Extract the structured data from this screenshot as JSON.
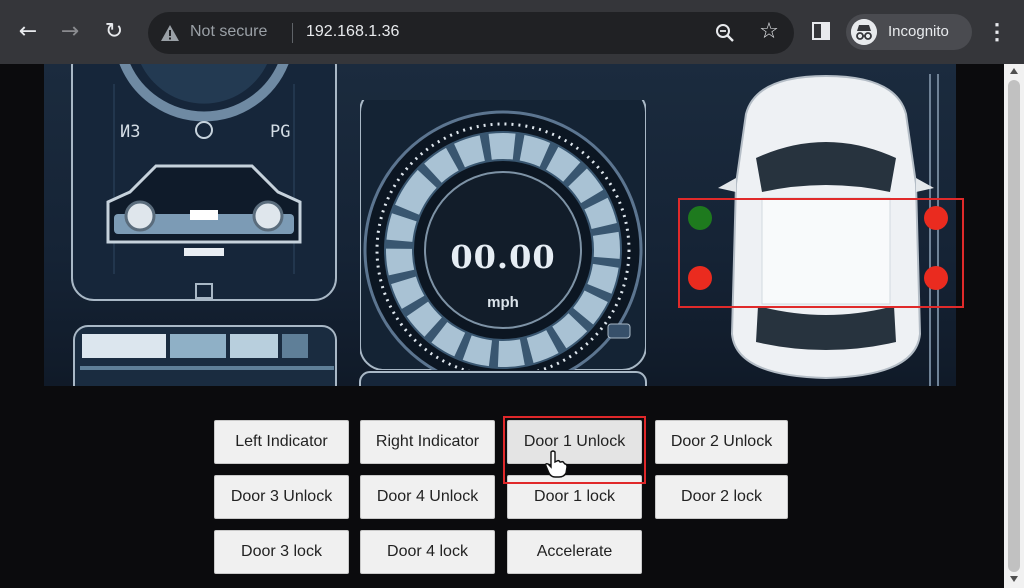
{
  "browser": {
    "security_label": "Not secure",
    "url": "192.168.1.36",
    "incognito_label": "Incognito",
    "icons": [
      "back-icon",
      "forward-icon",
      "reload-icon",
      "warning-icon",
      "zoom-icon",
      "star-icon",
      "side-panel-icon",
      "incognito-icon",
      "menu-icon"
    ]
  },
  "dashboard": {
    "left_gauge": {
      "left_label": "ИЗ",
      "right_label": "PG"
    },
    "speedometer": {
      "value": "00.00",
      "unit": "mph"
    },
    "doors": {
      "front_left": {
        "state": "unlocked",
        "color": "#1e7a1e"
      },
      "rear_left": {
        "state": "locked",
        "color": "#ea2b1f"
      },
      "front_right": {
        "state": "locked",
        "color": "#ea2b1f"
      },
      "rear_right": {
        "state": "locked",
        "color": "#ea2b1f"
      }
    }
  },
  "controls": {
    "buttons": [
      "Left Indicator",
      "Right Indicator",
      "Door 1 Unlock",
      "Door 2 Unlock",
      "Door 3 Unlock",
      "Door 4 Unlock",
      "Door 1 lock",
      "Door 2 lock",
      "Door 3 lock",
      "Door 4 lock",
      "Accelerate"
    ]
  },
  "colors": {
    "highlight": "#e0282a",
    "panel_bg": "#152335",
    "chrome_bg": "#35363a"
  }
}
